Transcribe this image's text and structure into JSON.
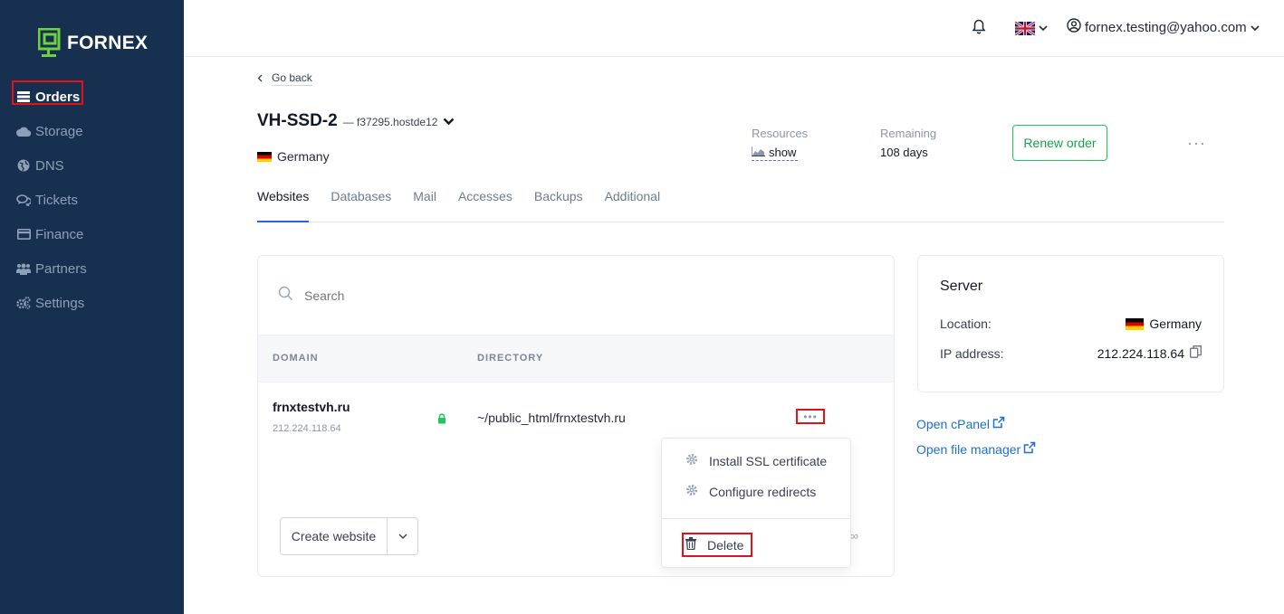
{
  "brand": {
    "name": "FORNEX"
  },
  "sidebar": {
    "items": [
      {
        "label": "Orders",
        "icon": "server-icon"
      },
      {
        "label": "Storage",
        "icon": "cloud-icon"
      },
      {
        "label": "DNS",
        "icon": "globe-icon"
      },
      {
        "label": "Tickets",
        "icon": "chat-icon"
      },
      {
        "label": "Finance",
        "icon": "card-icon"
      },
      {
        "label": "Partners",
        "icon": "users-icon"
      },
      {
        "label": "Settings",
        "icon": "gears-icon"
      }
    ]
  },
  "topbar": {
    "user_email": "fornex.testing@yahoo.com"
  },
  "page": {
    "go_back": "Go back",
    "title": "VH-SSD-2",
    "subtitle": "— f37295.hostde12",
    "location": "Germany",
    "resources_label": "Resources",
    "resources_value": "show",
    "remaining_label": "Remaining",
    "remaining_value": "108 days",
    "renew_label": "Renew order",
    "more_label": "···"
  },
  "tabs": [
    "Websites",
    "Databases",
    "Mail",
    "Accesses",
    "Backups",
    "Additional"
  ],
  "websites": {
    "search_placeholder": "Search",
    "columns": [
      "DOMAIN",
      "DIRECTORY"
    ],
    "rows": [
      {
        "domain": "frnxtestvh.ru",
        "ip": "212.224.118.64",
        "directory": "~/public_html/frnxtestvh.ru"
      }
    ],
    "create_label": "Create website",
    "counter": "/∞"
  },
  "menu": {
    "items": [
      "Install SSL certificate",
      "Configure redirects",
      "Delete"
    ]
  },
  "server": {
    "title": "Server",
    "location_label": "Location:",
    "location_value": "Germany",
    "ip_label": "IP address:",
    "ip_value": "212.224.118.64"
  },
  "links": {
    "cpanel": "Open cPanel",
    "file_manager": "Open file manager"
  },
  "colors": {
    "sidebar_bg": "#17304f",
    "accent": "#22c55e",
    "link": "#1d6fd1",
    "highlight": "#e2121b"
  }
}
